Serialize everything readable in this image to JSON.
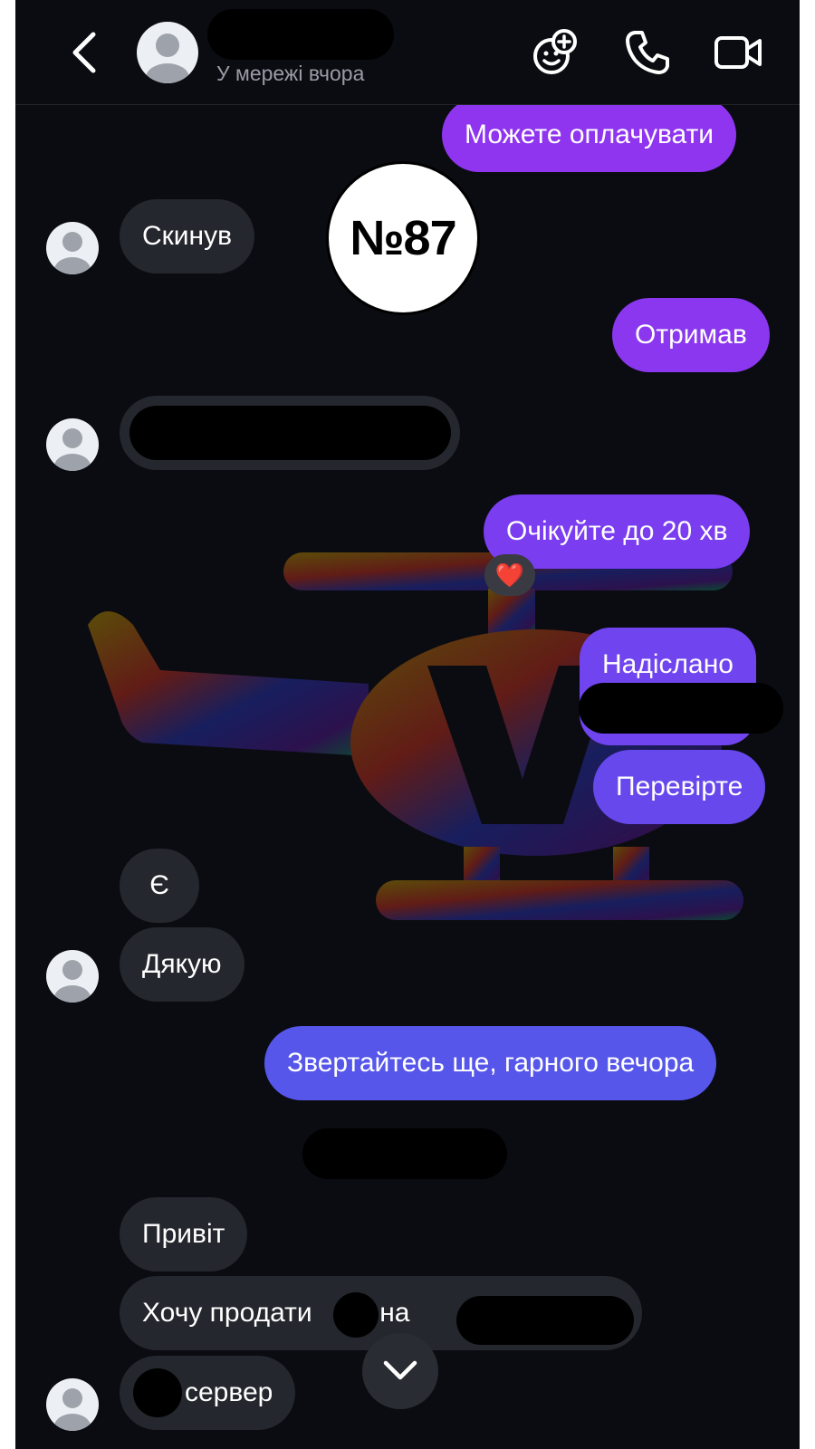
{
  "header": {
    "status": "У мережі вчора",
    "icons": [
      "chevron-left-icon",
      "avatar-placeholder-icon",
      "effects-icon",
      "phone-icon",
      "video-camera-icon"
    ]
  },
  "badge": {
    "label": "№87"
  },
  "messages": [
    {
      "side": "out",
      "text": "Можете оплачувати"
    },
    {
      "side": "in",
      "text": "Скинув"
    },
    {
      "side": "out",
      "text": "Отримав"
    },
    {
      "side": "in",
      "text": ""
    },
    {
      "side": "out",
      "text": "Очікуйте до 20 хв",
      "reaction": "❤️"
    },
    {
      "side": "out",
      "text": "Надіслано"
    },
    {
      "side": "out",
      "text": "Перевірте"
    },
    {
      "side": "in",
      "text": "Є"
    },
    {
      "side": "in",
      "text": "Дякую"
    },
    {
      "side": "out",
      "text": "Звертайтесь ще, гарного вечора"
    },
    {
      "side": "in",
      "text": "Привіт"
    },
    {
      "side": "in",
      "text_before": "Хочу продати",
      "text_mid": "кк на"
    },
    {
      "side": "in",
      "text": "сервер"
    }
  ],
  "colors": {
    "background": "#0b0c11",
    "incoming": "#25272e",
    "outgoing_top": "#8a36ef",
    "outgoing_bottom": "#5a55ea"
  }
}
